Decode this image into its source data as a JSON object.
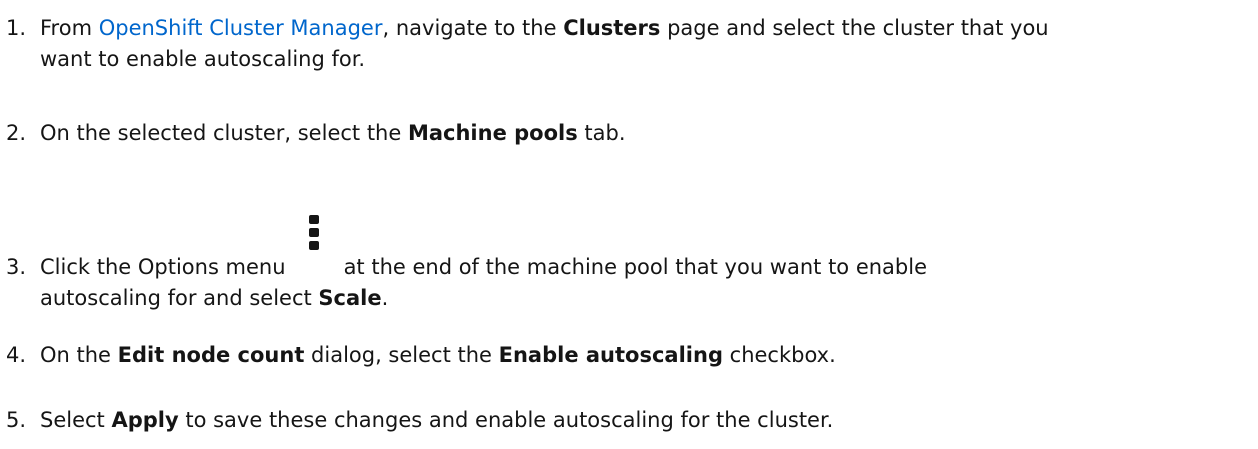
{
  "steps": [
    {
      "number": "1.",
      "pre": "From ",
      "link": "OpenShift Cluster Manager",
      "mid": ", navigate to the ",
      "bold": "Clusters",
      "post": " page and select the cluster that you",
      "line2": "want to enable autoscaling for."
    },
    {
      "number": "2.",
      "pre": "On the selected cluster, select the ",
      "bold": "Machine pools",
      "post": " tab."
    },
    {
      "number": "3.",
      "pre": "Click the Options menu",
      "icon": "kebab-options-icon",
      "post": "at the end of the machine pool that you want to enable",
      "line2_pre": "autoscaling for and select ",
      "line2_bold": "Scale",
      "line2_post": "."
    },
    {
      "number": "4.",
      "pre": "On the ",
      "bold1": "Edit node count",
      "mid": " dialog, select the ",
      "bold2": "Enable autoscaling",
      "post": " checkbox."
    },
    {
      "number": "5.",
      "pre": "Select ",
      "bold": "Apply",
      "post": " to save these changes and enable autoscaling for the cluster."
    }
  ],
  "colors": {
    "text": "#151515",
    "link": "#0066cc"
  }
}
